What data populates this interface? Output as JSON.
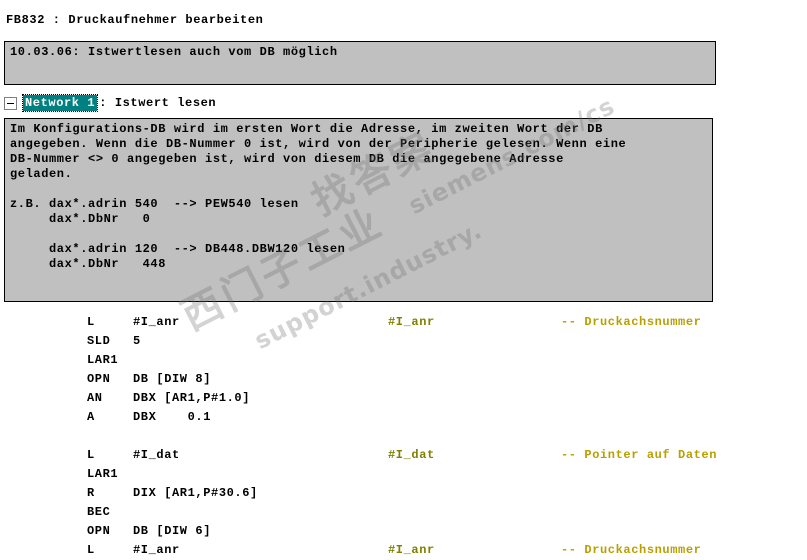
{
  "block": {
    "title": "FB832 : Druckaufnehmer bearbeiten",
    "comment": "10.03.06: Istwertlesen auch vom DB möglich"
  },
  "network": {
    "collapse_icon": "minus-box-icon",
    "label": "Network 1",
    "title": ": Istwert lesen",
    "highlight_color": "#008080",
    "comment": "Im Konfigurations-DB wird im ersten Wort die Adresse, im zweiten Wort der DB\nangegeben. Wenn die DB-Nummer 0 ist, wird von der Peripherie gelesen. Wenn eine\nDB-Nummer <> 0 angegeben ist, wird von diesem DB die angegebene Adresse\ngeladen.\n\nz.B. dax*.adrin 540  --> PEW540 lesen\n     dax*.DbNr   0\n\n     dax*.adrin 120  --> DB448.DBW120 lesen\n     dax*.DbNr   448"
  },
  "code": {
    "comment_color": "#b8a000",
    "symbol_color": "#808000",
    "rows": [
      {
        "op": "L",
        "arg": "#I_anr",
        "sym": "#I_anr",
        "cmt": "-- Druckachsnummer"
      },
      {
        "op": "SLD",
        "arg": "5",
        "sym": "",
        "cmt": ""
      },
      {
        "op": "LAR1",
        "arg": "",
        "sym": "",
        "cmt": ""
      },
      {
        "op": "OPN",
        "arg": "DB [DIW 8]",
        "sym": "",
        "cmt": ""
      },
      {
        "op": "AN",
        "arg": "DBX [AR1,P#1.0]",
        "sym": "",
        "cmt": ""
      },
      {
        "op": "A",
        "arg": "DBX    0.1",
        "sym": "",
        "cmt": ""
      },
      {
        "op": "",
        "arg": "",
        "sym": "",
        "cmt": ""
      },
      {
        "op": "L",
        "arg": "#I_dat",
        "sym": "#I_dat",
        "cmt": "-- Pointer auf Daten"
      },
      {
        "op": "LAR1",
        "arg": "",
        "sym": "",
        "cmt": ""
      },
      {
        "op": "R",
        "arg": "DIX [AR1,P#30.6]",
        "sym": "",
        "cmt": ""
      },
      {
        "op": "BEC",
        "arg": "",
        "sym": "",
        "cmt": ""
      },
      {
        "op": "OPN",
        "arg": "DB [DIW 6]",
        "sym": "",
        "cmt": ""
      },
      {
        "op": "L",
        "arg": "#I_anr",
        "sym": "#I_anr",
        "cmt": "-- Druckachsnummer"
      }
    ]
  },
  "watermark": {
    "cn_left": "找答案",
    "cn_right": "西门子工业",
    "url_top": "siemens.com/cs",
    "url_bottom": "support.industry."
  }
}
